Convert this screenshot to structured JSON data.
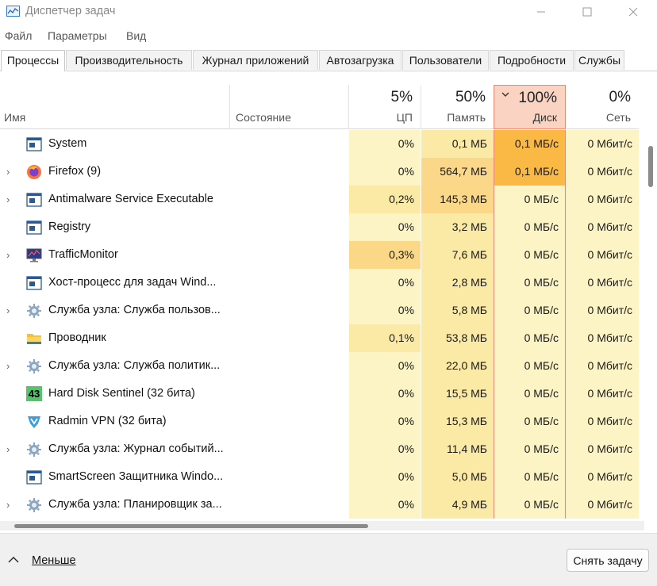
{
  "window": {
    "title": "Диспетчер задач"
  },
  "menu": [
    "Файл",
    "Параметры",
    "Вид"
  ],
  "tabs": [
    "Процессы",
    "Производительность",
    "Журнал приложений",
    "Автозагрузка",
    "Пользователи",
    "Подробности",
    "Службы"
  ],
  "columns": {
    "name": "Имя",
    "status": "Состояние",
    "cpu": {
      "pct": "5%",
      "label": "ЦП"
    },
    "mem": {
      "pct": "50%",
      "label": "Память"
    },
    "disk": {
      "pct": "100%",
      "label": "Диск"
    },
    "net": {
      "pct": "0%",
      "label": "Сеть"
    }
  },
  "processes": [
    {
      "name": "System",
      "icon": "app-window-icon",
      "expandable": false,
      "cpu": "0%",
      "mem": "0,1 МБ",
      "disk": "0,1 МБ/с",
      "net": "0 Мбит/с"
    },
    {
      "name": "Firefox (9)",
      "icon": "firefox-icon",
      "expandable": true,
      "cpu": "0%",
      "mem": "564,7 МБ",
      "disk": "0,1 МБ/с",
      "net": "0 Мбит/с"
    },
    {
      "name": "Antimalware Service Executable",
      "icon": "app-window-icon",
      "expandable": true,
      "cpu": "0,2%",
      "mem": "145,3 МБ",
      "disk": "0 МБ/с",
      "net": "0 Мбит/с"
    },
    {
      "name": "Registry",
      "icon": "app-window-icon",
      "expandable": false,
      "cpu": "0%",
      "mem": "3,2 МБ",
      "disk": "0 МБ/с",
      "net": "0 Мбит/с"
    },
    {
      "name": "TrafficMonitor",
      "icon": "monitor-icon",
      "expandable": true,
      "cpu": "0,3%",
      "mem": "7,6 МБ",
      "disk": "0 МБ/с",
      "net": "0 Мбит/с"
    },
    {
      "name": "Хост-процесс для задач Wind...",
      "icon": "app-window-icon",
      "expandable": false,
      "cpu": "0%",
      "mem": "2,8 МБ",
      "disk": "0 МБ/с",
      "net": "0 Мбит/с"
    },
    {
      "name": "Служба узла: Служба пользов...",
      "icon": "gear-icon",
      "expandable": true,
      "cpu": "0%",
      "mem": "5,8 МБ",
      "disk": "0 МБ/с",
      "net": "0 Мбит/с"
    },
    {
      "name": "Проводник",
      "icon": "folder-icon",
      "expandable": false,
      "cpu": "0,1%",
      "mem": "53,8 МБ",
      "disk": "0 МБ/с",
      "net": "0 Мбит/с"
    },
    {
      "name": "Служба узла: Служба политик...",
      "icon": "gear-icon",
      "expandable": true,
      "cpu": "0%",
      "mem": "22,0 МБ",
      "disk": "0 МБ/с",
      "net": "0 Мбит/с"
    },
    {
      "name": "Hard Disk Sentinel (32 бита)",
      "icon": "hds-43-icon",
      "icon_text": "43",
      "expandable": false,
      "cpu": "0%",
      "mem": "15,5 МБ",
      "disk": "0 МБ/с",
      "net": "0 Мбит/с"
    },
    {
      "name": "Radmin VPN (32 бита)",
      "icon": "shield-icon",
      "expandable": false,
      "cpu": "0%",
      "mem": "15,3 МБ",
      "disk": "0 МБ/с",
      "net": "0 Мбит/с"
    },
    {
      "name": "Служба узла: Журнал событий...",
      "icon": "gear-icon",
      "expandable": true,
      "cpu": "0%",
      "mem": "11,4 МБ",
      "disk": "0 МБ/с",
      "net": "0 Мбит/с"
    },
    {
      "name": "SmartScreen Защитника Windo...",
      "icon": "app-window-icon",
      "expandable": false,
      "cpu": "0%",
      "mem": "5,0 МБ",
      "disk": "0 МБ/с",
      "net": "0 Мбит/с"
    },
    {
      "name": "Служба узла: Планировщик за...",
      "icon": "gear-icon",
      "expandable": true,
      "cpu": "0%",
      "mem": "4,9 МБ",
      "disk": "0 МБ/с",
      "net": "0 Мбит/с"
    }
  ],
  "footer": {
    "less_label": "Меньше",
    "end_task_label": "Снять задачу"
  },
  "colors": {
    "heat_light": "#fdf4c5",
    "heat_medium": "#fbe9a6",
    "heat_strong": "#fad888",
    "mem_high": "#fbd889",
    "disk_hot": "#f9b944",
    "disk_header": "#fad3c2",
    "disk_border": "#e88a72"
  }
}
